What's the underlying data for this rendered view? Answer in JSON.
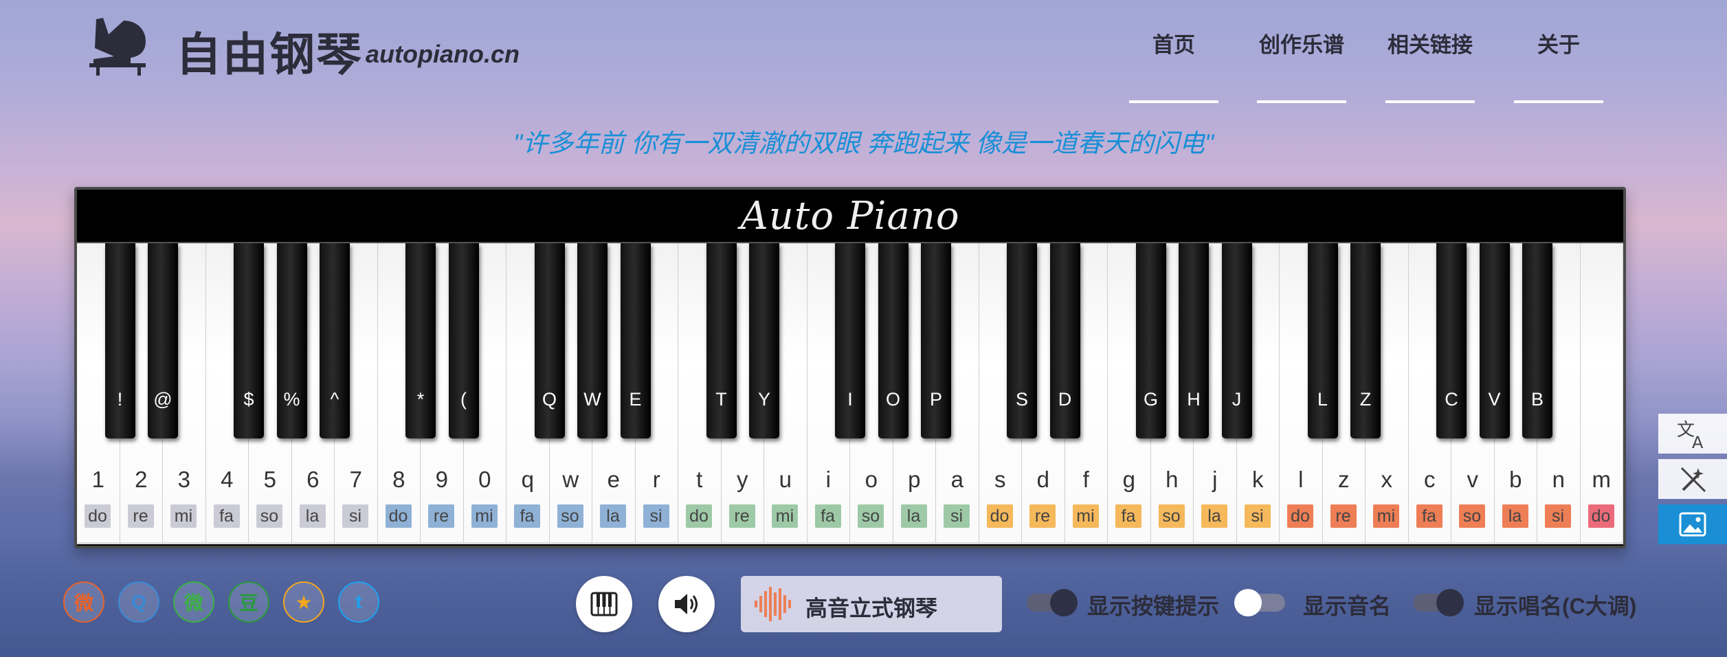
{
  "header": {
    "title": "自由钢琴",
    "domain": "autopiano.cn",
    "nav": [
      "首页",
      "创作乐谱",
      "相关链接",
      "关于"
    ]
  },
  "quote": "\"许多年前 你有一双清澈的双眼 奔跑起来 像是一道春天的闪电\"",
  "piano": {
    "brand": "Auto Piano",
    "white_keys": [
      {
        "key": "1",
        "solfege": "do"
      },
      {
        "key": "2",
        "solfege": "re"
      },
      {
        "key": "3",
        "solfege": "mi"
      },
      {
        "key": "4",
        "solfege": "fa"
      },
      {
        "key": "5",
        "solfege": "so"
      },
      {
        "key": "6",
        "solfege": "la"
      },
      {
        "key": "7",
        "solfege": "si"
      },
      {
        "key": "8",
        "solfege": "do"
      },
      {
        "key": "9",
        "solfege": "re"
      },
      {
        "key": "0",
        "solfege": "mi"
      },
      {
        "key": "q",
        "solfege": "fa"
      },
      {
        "key": "w",
        "solfege": "so"
      },
      {
        "key": "e",
        "solfege": "la"
      },
      {
        "key": "r",
        "solfege": "si"
      },
      {
        "key": "t",
        "solfege": "do"
      },
      {
        "key": "y",
        "solfege": "re"
      },
      {
        "key": "u",
        "solfege": "mi"
      },
      {
        "key": "i",
        "solfege": "fa"
      },
      {
        "key": "o",
        "solfege": "so"
      },
      {
        "key": "p",
        "solfege": "la"
      },
      {
        "key": "a",
        "solfege": "si"
      },
      {
        "key": "s",
        "solfege": "do"
      },
      {
        "key": "d",
        "solfege": "re"
      },
      {
        "key": "f",
        "solfege": "mi"
      },
      {
        "key": "g",
        "solfege": "fa"
      },
      {
        "key": "h",
        "solfege": "so"
      },
      {
        "key": "j",
        "solfege": "la"
      },
      {
        "key": "k",
        "solfege": "si"
      },
      {
        "key": "l",
        "solfege": "do"
      },
      {
        "key": "z",
        "solfege": "re"
      },
      {
        "key": "x",
        "solfege": "mi"
      },
      {
        "key": "c",
        "solfege": "fa"
      },
      {
        "key": "v",
        "solfege": "so"
      },
      {
        "key": "b",
        "solfege": "la"
      },
      {
        "key": "n",
        "solfege": "si"
      },
      {
        "key": "m",
        "solfege": "do"
      }
    ],
    "black_keys": [
      "!",
      "@",
      "$",
      "%",
      "^",
      "*",
      "(",
      "Q",
      "W",
      "E",
      "T",
      "Y",
      "I",
      "O",
      "P",
      "S",
      "D",
      "G",
      "H",
      "J",
      "L",
      "Z",
      "C",
      "V",
      "B"
    ],
    "octave_colors": [
      "#cbcbd6",
      "#8fb1d6",
      "#9ec9a7",
      "#f5b85a",
      "#ee7e55",
      "#ec6b7a"
    ]
  },
  "footer": {
    "social": [
      {
        "name": "weibo",
        "glyph": "微",
        "color": "#e8632a"
      },
      {
        "name": "qq",
        "glyph": "Q",
        "color": "#3a8ad6"
      },
      {
        "name": "wechat",
        "glyph": "微",
        "color": "#3cb045"
      },
      {
        "name": "douban",
        "glyph": "豆",
        "color": "#2a9a3c"
      },
      {
        "name": "qzone",
        "glyph": "★",
        "color": "#f2a71e"
      },
      {
        "name": "twitter",
        "glyph": "t",
        "color": "#1da1f2"
      }
    ],
    "instrument": "高音立式钢琴",
    "toggles": [
      {
        "label": "显示按键提示",
        "on": true
      },
      {
        "label": "显示音名",
        "on": false
      },
      {
        "label": "显示唱名(C大调)",
        "on": true
      }
    ]
  }
}
